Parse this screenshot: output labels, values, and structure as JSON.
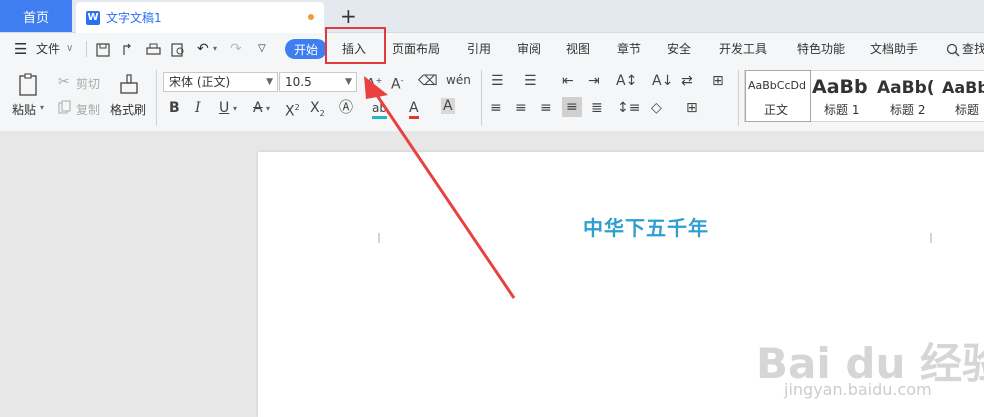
{
  "tabs": {
    "home": "首页",
    "document": "文字文稿1",
    "doc_icon": "W",
    "new_tab": "+"
  },
  "menu": {
    "file": "文件",
    "start": "开始",
    "items": [
      "插入",
      "页面布局",
      "引用",
      "审阅",
      "视图",
      "章节",
      "安全",
      "开发工具",
      "特色功能",
      "文档助手"
    ],
    "search": "查找"
  },
  "ribbon": {
    "paste": "粘贴",
    "cut": "剪切",
    "copy": "复制",
    "format_painter": "格式刷",
    "font_name": "宋体 (正文)",
    "font_size": "10.5",
    "styles": [
      {
        "sample": "AaBbCcDd",
        "name": "正文"
      },
      {
        "sample": "AaBb",
        "name": "标题 1"
      },
      {
        "sample": "AaBb(",
        "name": "标题 2"
      },
      {
        "sample": "AaBb",
        "name": "标题"
      }
    ]
  },
  "document": {
    "title": "中华下五千年"
  },
  "watermark": {
    "logo": "Bai du 经验",
    "url": "jingyan.baidu.com"
  },
  "colors": {
    "accent": "#3f7ef0",
    "highlight_box": "#e03a3a",
    "arrow": "#e8413f",
    "doc_title": "#2e9fcf"
  }
}
